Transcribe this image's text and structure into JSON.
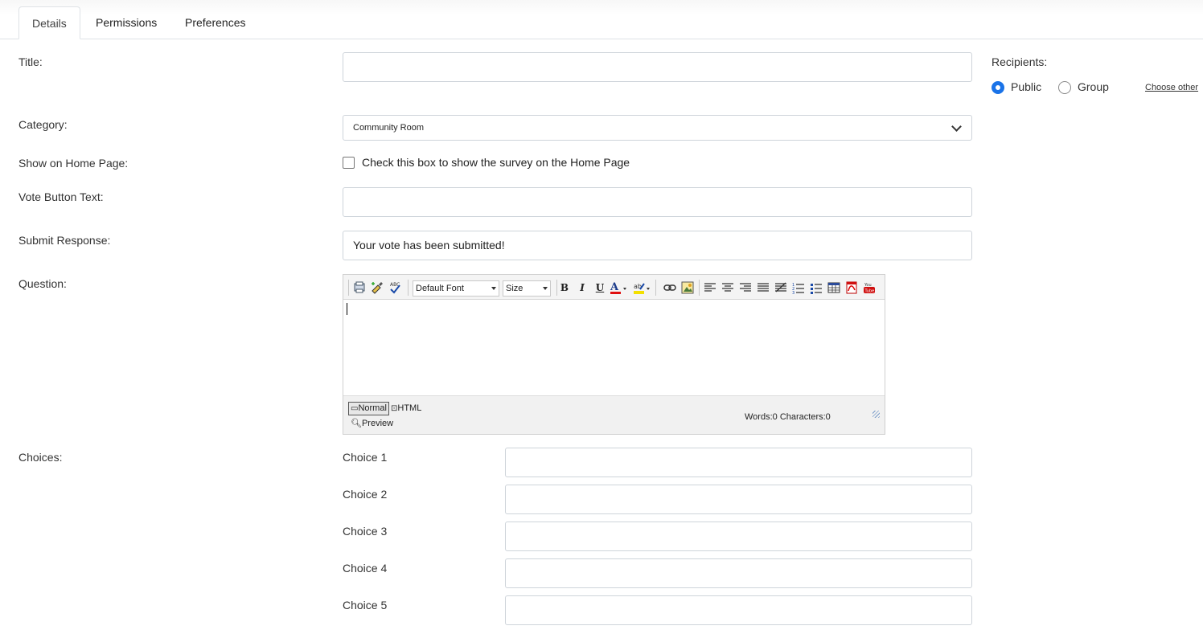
{
  "tabs": [
    {
      "label": "Details",
      "active": true
    },
    {
      "label": "Permissions",
      "active": false
    },
    {
      "label": "Preferences",
      "active": false
    }
  ],
  "form": {
    "title_label": "Title:",
    "title_value": "",
    "category_label": "Category:",
    "category_value": "Community Room",
    "show_home_label": "Show on Home Page:",
    "show_home_checkbox_text": "Check this box to show the survey on the Home Page",
    "show_home_checked": false,
    "vote_button_label": "Vote Button Text:",
    "vote_button_value": "",
    "submit_response_label": "Submit Response:",
    "submit_response_value": "Your vote has been submitted!",
    "question_label": "Question:",
    "choices_label": "Choices:"
  },
  "recipients": {
    "label": "Recipients:",
    "options": [
      {
        "label": "Public",
        "selected": true
      },
      {
        "label": "Group",
        "selected": false
      }
    ],
    "choose_other": "Choose other"
  },
  "editor": {
    "font_select": "Default Font",
    "size_select": "Size",
    "mode_normal": "Normal",
    "mode_html": "HTML",
    "mode_preview": "Preview",
    "words_count": "Words:0",
    "characters_count": "Characters:0"
  },
  "choices": [
    {
      "label": "Choice 1",
      "value": ""
    },
    {
      "label": "Choice 2",
      "value": ""
    },
    {
      "label": "Choice 3",
      "value": ""
    },
    {
      "label": "Choice 4",
      "value": ""
    },
    {
      "label": "Choice 5",
      "value": ""
    }
  ],
  "colors": {
    "accent": "#1a73e8",
    "border": "#ced4da"
  }
}
